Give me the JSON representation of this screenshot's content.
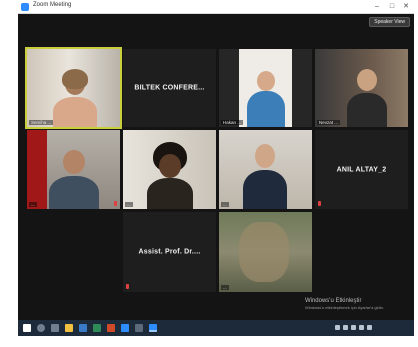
{
  "window": {
    "title": "Zoom Meeting",
    "minimize": "–",
    "maximize": "□",
    "close": "✕",
    "speaker_view_label": "Speaker View"
  },
  "participants": [
    {
      "name": "Semiha ...",
      "video": true
    },
    {
      "name": "BILTEK CONFERE...",
      "video": false
    },
    {
      "name": "Hakan ...",
      "video": true
    },
    {
      "name": "Nevzat ...",
      "video": true
    },
    {
      "name": "...",
      "video": true
    },
    {
      "name": "...",
      "video": true
    },
    {
      "name": "...",
      "video": true
    },
    {
      "name": "ANIL ALTAY_2",
      "video": false
    },
    {
      "name": "Assist. Prof. Dr....",
      "video": false
    },
    {
      "name": "...",
      "video": true
    }
  ],
  "watermark": {
    "line1": "Windows'u Etkinleştir",
    "line2": "Windows'u etkinleştirmek için Ayarlar'a gidin."
  },
  "taskbar": {
    "time": "",
    "date": ""
  },
  "colors": {
    "active_speaker_border": "#c9cf3a",
    "muted_mic": "#e04040",
    "meeting_bg": "#141414",
    "taskbar_bg": "#1c2a3a"
  }
}
